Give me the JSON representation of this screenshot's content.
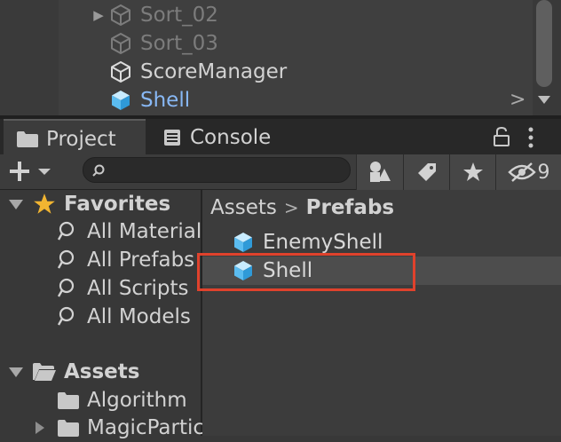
{
  "hierarchy": {
    "items": [
      {
        "label": "Sort_02",
        "state": "inactive",
        "has_children": true
      },
      {
        "label": "Sort_03",
        "state": "inactive",
        "has_children": false
      },
      {
        "label": "ScoreManager",
        "state": "normal",
        "has_children": false
      },
      {
        "label": "Shell",
        "state": "selected",
        "has_children": false
      }
    ]
  },
  "tabs": {
    "project": "Project",
    "console": "Console"
  },
  "toolbar": {
    "hidden_count": "9",
    "search_placeholder": ""
  },
  "tree": {
    "favorites": {
      "label": "Favorites",
      "items": [
        "All Material",
        "All Prefabs",
        "All Scripts",
        "All Models"
      ]
    },
    "assets": {
      "label": "Assets",
      "items": [
        "Algorithm",
        "MagicPartic"
      ]
    }
  },
  "content": {
    "breadcrumb": [
      "Assets",
      "Prefabs"
    ],
    "items": [
      "EnemyShell",
      "Shell"
    ],
    "selected_item": "Shell"
  },
  "colors": {
    "accent_blue": "#88b8f5",
    "highlight": "#e0422c",
    "star": "#f2b531"
  }
}
